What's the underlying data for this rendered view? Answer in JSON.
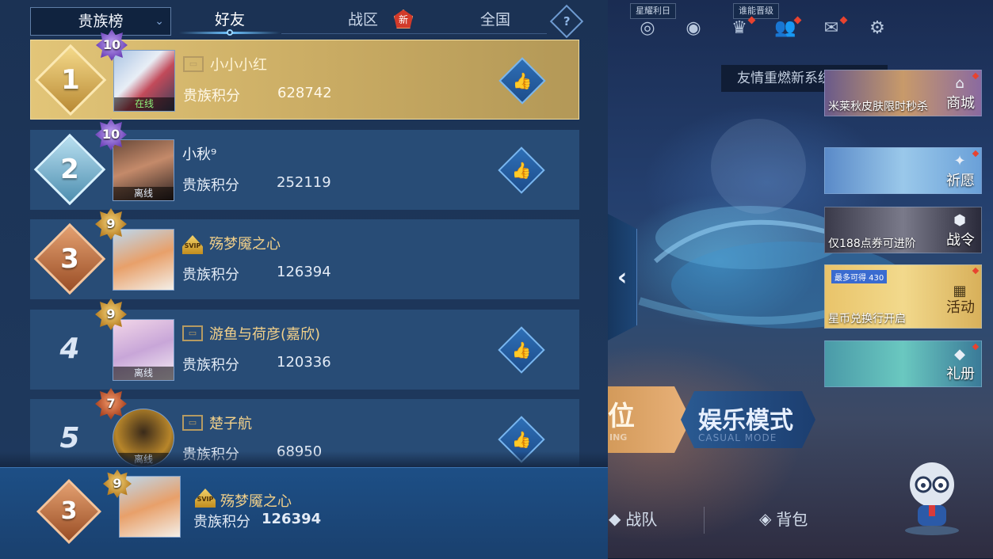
{
  "tabs": {
    "dropdown_label": "贵族榜",
    "items": [
      {
        "label": "好友",
        "active": true
      },
      {
        "label": "战区",
        "badge": "新"
      },
      {
        "label": "全国"
      }
    ],
    "help": "?"
  },
  "leaderboard": [
    {
      "rank": "1",
      "vip": "10",
      "status": "在线",
      "name": "小小小红",
      "score_label": "贵族积分",
      "score": "628742"
    },
    {
      "rank": "2",
      "vip": "10",
      "status": "离线",
      "name": "小秋⁹",
      "score_label": "贵族积分",
      "score": "252119"
    },
    {
      "rank": "3",
      "vip": "9",
      "status": "",
      "name": "殇梦魇之心",
      "score_label": "贵族积分",
      "score": "126394"
    },
    {
      "rank": "4",
      "vip": "9",
      "status": "离线",
      "name": "游鱼与荷彦(嘉欣)",
      "score_label": "贵族积分",
      "score": "120336"
    },
    {
      "rank": "5",
      "vip": "7",
      "status": "离线",
      "name": "楚子航",
      "score_label": "贵族积分",
      "score": "68950"
    }
  ],
  "self": {
    "rank": "3",
    "vip": "9",
    "name": "殇梦魇之心",
    "score_label": "贵族积分",
    "score": "126394",
    "svip": "SVIP"
  },
  "scene": {
    "tag_left": "星耀利日",
    "tag_right": "谁能晋级",
    "notice": "友情重燃新系统上线",
    "side_cards": [
      {
        "caption": "米莱秋皮肤限时秒杀",
        "action": "商城"
      },
      {
        "caption": "",
        "action": "祈愿"
      },
      {
        "caption": "仅188点券可进阶",
        "action": "战令"
      },
      {
        "caption": "星币兑换行开启",
        "action": "活动",
        "top": "最多可得 430"
      },
      {
        "caption": "",
        "action": "礼册"
      }
    ],
    "mode_left": "位",
    "mode_left_sub": "ING",
    "mode_title": "娱乐模式",
    "mode_sub": "CASUAL MODE",
    "nav_team": "战队",
    "nav_bag": "背包"
  },
  "colors": {
    "gold": "#e2c578",
    "row": "#284c76",
    "accent": "#6ec3ff"
  }
}
